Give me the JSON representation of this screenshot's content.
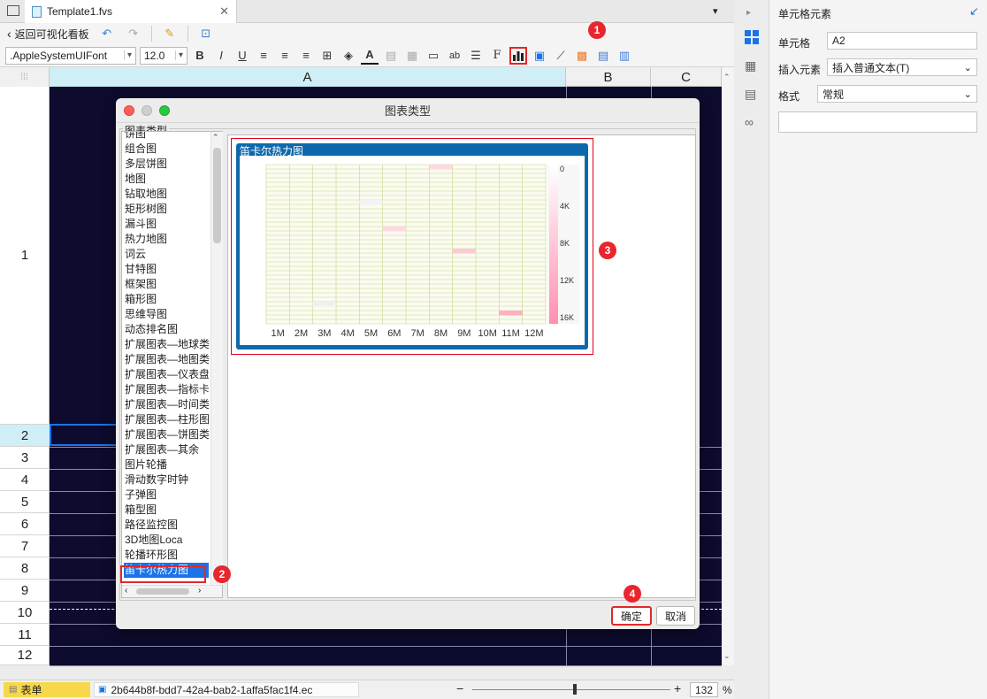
{
  "tab": {
    "title": "Template1.fvs",
    "close": "✕"
  },
  "toolbar": {
    "back_label": "返回可视化看板",
    "font_name": ".AppleSystemUIFont",
    "font_size": "12.0"
  },
  "columns": [
    "A",
    "B",
    "C"
  ],
  "rows": [
    "1",
    "2",
    "3",
    "4",
    "5",
    "6",
    "7",
    "8",
    "9",
    "10",
    "11",
    "12"
  ],
  "right_panel": {
    "title": "单元格元素",
    "cell_label": "单元格",
    "cell_value": "A2",
    "insert_label": "插入元素",
    "insert_value": "插入普通文本(T)",
    "format_label": "格式",
    "format_value": "常规"
  },
  "dialog": {
    "title": "图表类型",
    "group_label": "图表类型",
    "chart_types": [
      "饼图",
      "组合图",
      "多层饼图",
      "地图",
      "钻取地图",
      "矩形树图",
      "漏斗图",
      "热力地图",
      "词云",
      "甘特图",
      "框架图",
      "箱形图",
      "思维导图",
      "动态排名图",
      "扩展图表—地球类",
      "扩展图表—地图类",
      "扩展图表—仪表盘",
      "扩展图表—指标卡",
      "扩展图表—时间类",
      "扩展图表—柱形图",
      "扩展图表—饼图类",
      "扩展图表—其余",
      "图片轮播",
      "滑动数字时钟",
      "子弹图",
      "箱型图",
      "路径监控图",
      "3D地图Loca",
      "轮播环形图",
      "笛卡尔热力图"
    ],
    "selected": "笛卡尔热力图",
    "preview_title": "笛卡尔热力图",
    "ok": "确定",
    "cancel": "取消"
  },
  "chart_data": {
    "type": "heatmap",
    "categories": [
      "1M",
      "2M",
      "3M",
      "4M",
      "5M",
      "6M",
      "7M",
      "8M",
      "9M",
      "10M",
      "11M",
      "12M"
    ],
    "colorbar_ticks": [
      "0",
      "4K",
      "8K",
      "12K",
      "16K"
    ],
    "colors": {
      "low": "#ffffff",
      "high": "#ff8fb0",
      "grid": "#c8d68c"
    }
  },
  "bottom": {
    "sheet": "表单",
    "file_id": "2b644b8f-bdd7-42a4-bab2-1affa5fac1f4.ec",
    "zoom": "132",
    "zoom_unit": "%"
  },
  "badges": [
    "1",
    "2",
    "3",
    "4"
  ]
}
